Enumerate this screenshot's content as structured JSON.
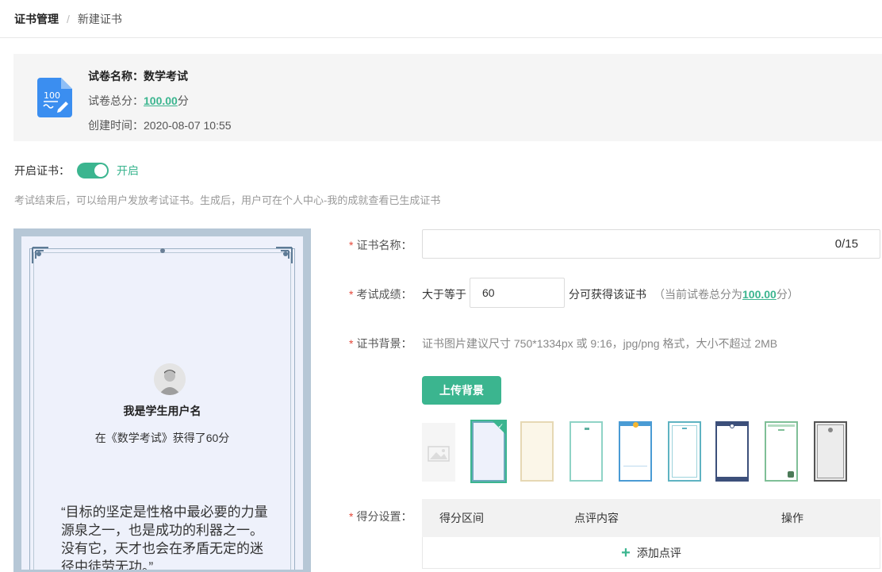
{
  "breadcrumb": {
    "root": "证书管理",
    "separator": "/",
    "current": "新建证书"
  },
  "paper": {
    "name_label": "试卷名称：",
    "name_value": "数学考试",
    "total_label": "试卷总分：",
    "total_value": "100.00",
    "total_unit": "分",
    "created_label": "创建时间：",
    "created_value": "2020-08-07 10:55",
    "icon": "exam-paper-icon",
    "icon_text": "100"
  },
  "certificate_toggle": {
    "label": "开启证书：",
    "state_text": "开启",
    "on": true
  },
  "hint": "考试结束后，可以给用户发放考试证书。生成后，用户可在个人中心-我的成就查看已生成证书",
  "preview": {
    "student_name": "我是学生用户名",
    "result_text": "在《数学考试》获得了60分",
    "quote": "“目标的坚定是性格中最必要的力量源泉之一，也是成功的利器之一。没有它，天才也会在矛盾无定的迷径中徒劳无功。”"
  },
  "form": {
    "name_label": "证书名称：",
    "name_counter": "0/15",
    "score_label": "考试成绩：",
    "score_prefix": "大于等于",
    "score_value": "60",
    "score_suffix": "分可获得该证书",
    "score_note_prefix": "（当前试卷总分为",
    "score_note_value": "100.00",
    "score_note_suffix": "分）",
    "bg_label": "证书背景：",
    "bg_hint": "证书图片建议尺寸 750*1334px 或 9:16，jpg/png 格式，大小不超过 2MB",
    "upload_button": "上传背景",
    "required_mark": "*",
    "templates": [
      "image-placeholder-icon",
      "template-blue-floral",
      "template-beige",
      "template-teal-frame",
      "template-blue-medal",
      "template-teal-double",
      "template-navy",
      "template-green",
      "template-gray"
    ],
    "selected_template_index": 1,
    "scoring_label": "得分设置：",
    "table_headers": [
      "得分区间",
      "点评内容",
      "操作"
    ],
    "add_comment": "添加点评"
  }
}
